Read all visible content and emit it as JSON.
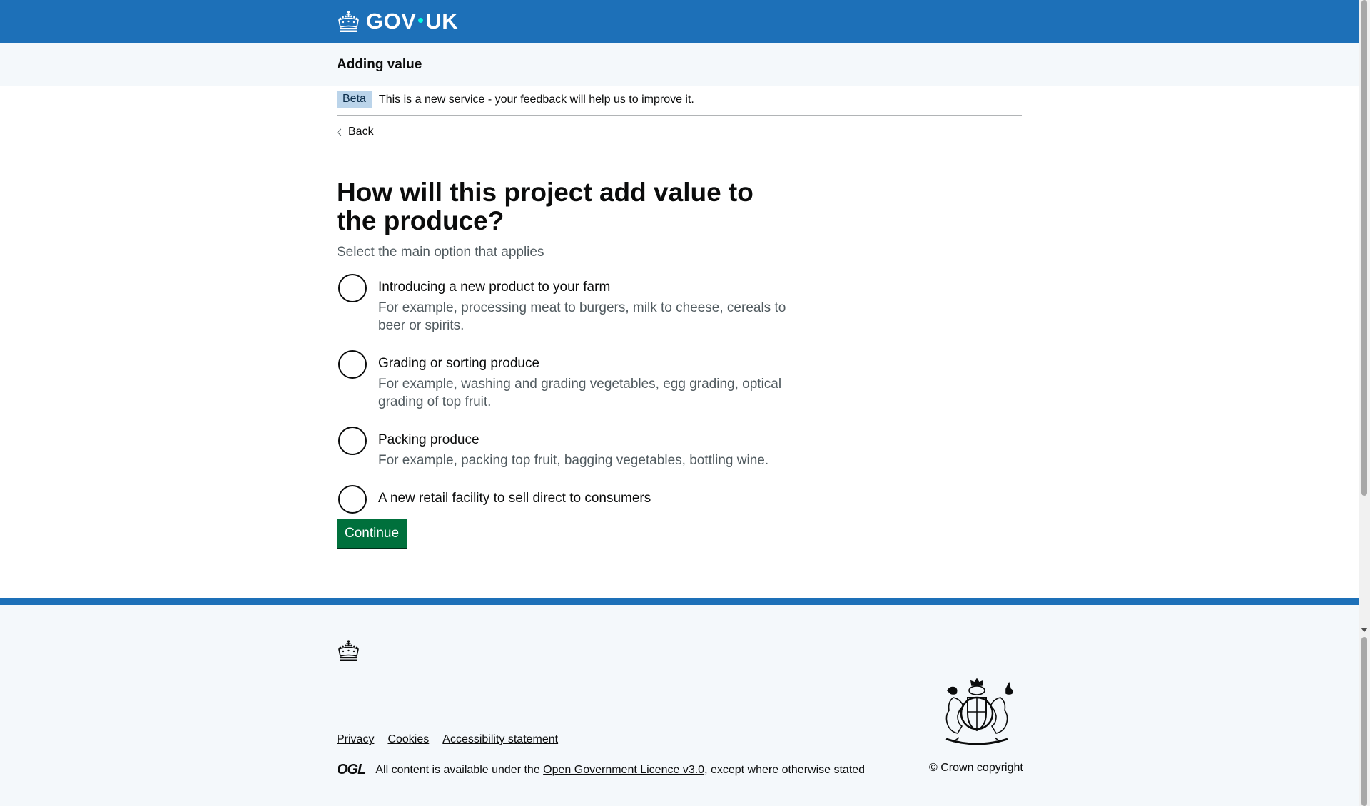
{
  "header": {
    "logo_text_left": "GOV",
    "logo_text_right": "UK",
    "logo_icon": "crown-icon"
  },
  "service": {
    "name": "Adding value"
  },
  "phase_banner": {
    "tag": "Beta",
    "text": "This is a new service - your feedback will help us to improve it."
  },
  "back": {
    "label": "Back"
  },
  "question": {
    "heading": "How will this project add value to the produce?",
    "hint": "Select the main option that applies",
    "options": [
      {
        "label": "Introducing a new product to your farm",
        "hint": "For example, processing meat to burgers, milk to cheese, cereals to beer or spirits."
      },
      {
        "label": "Grading or sorting produce",
        "hint": "For example, washing and grading vegetables, egg grading, optical grading of top fruit."
      },
      {
        "label": "Packing produce",
        "hint": "For example, packing top fruit, bagging vegetables, bottling wine."
      },
      {
        "label": "A new retail facility to sell direct to consumers",
        "hint": ""
      }
    ]
  },
  "actions": {
    "continue_label": "Continue"
  },
  "footer": {
    "links": [
      "Privacy",
      "Cookies",
      "Accessibility statement"
    ],
    "ogl_text": "OGL",
    "licence_prefix": "All content is available under the ",
    "licence_link": "Open Government Licence v3.0",
    "licence_suffix": ", except where otherwise stated",
    "copyright": "© Crown copyright",
    "crest_icon": "royal-coat-of-arms-icon"
  },
  "colors": {
    "header_blue": "#1d70b8",
    "button_green": "#00703c",
    "text": "#0b0c0c",
    "secondary_text": "#505a5f"
  }
}
